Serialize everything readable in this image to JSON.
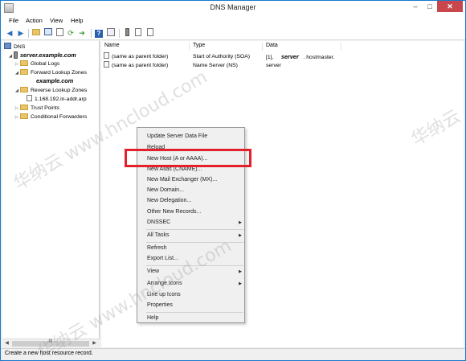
{
  "window": {
    "title": "DNS Manager",
    "min_glyph": "–",
    "max_glyph": "□",
    "close_glyph": "✕"
  },
  "menu": [
    "File",
    "Action",
    "View",
    "Help"
  ],
  "toolbar": {
    "icons": [
      "back-arrow-icon",
      "forward-arrow-icon",
      "up-folder-icon",
      "console-tree-icon",
      "properties-icon",
      "refresh-icon",
      "export-icon",
      "help-icon",
      "server-icon",
      "zone-icon",
      "record-icon"
    ]
  },
  "tree": {
    "root": "DNS",
    "server": "server.example.com",
    "global_logs": "Global Logs",
    "forward_zones": "Forward Lookup Zones",
    "forward_zone_child": "example.com",
    "reverse_zones": "Reverse Lookup Zones",
    "reverse_zone_child": "1.168.192.in-addr.arp",
    "trust_points": "Trust Points",
    "conditional_forwarders": "Conditional Forwarders",
    "scroll_thumb": "III"
  },
  "list": {
    "columns": [
      "Name",
      "Type",
      "Data"
    ],
    "rows": [
      {
        "name": "(same as parent folder)",
        "type": "Start of Authority (SOA)",
        "data_prefix": "[1],",
        "data_overlay": "server",
        "data_suffix": ". hostmaster."
      },
      {
        "name": "(same as parent folder)",
        "type": "Name Server (NS)",
        "data": "server"
      }
    ]
  },
  "context_menu": {
    "items": [
      "Update Server Data File",
      "Reload",
      "New Host (A or AAAA)...",
      "New Alias (CNAME)...",
      "New Mail Exchanger (MX)...",
      "New Domain...",
      "New Delegation...",
      "Other New Records...",
      "DNSSEC",
      "All Tasks",
      "Refresh",
      "Export List...",
      "View",
      "Arrange Icons",
      "Line up Icons",
      "Properties",
      "Help"
    ],
    "highlighted": "New Host (A or AAAA)...",
    "highlight_color": "#e3202b"
  },
  "status": "Create a new host resource record.",
  "watermark": {
    "cn": "华纳云",
    "url": "www.hncloud.com"
  }
}
